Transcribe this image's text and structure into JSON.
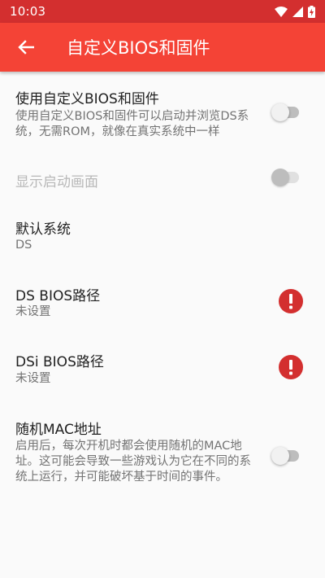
{
  "status_bar": {
    "time": "10:03",
    "icons": [
      "wifi-icon",
      "signal-icon",
      "battery-charging-icon"
    ]
  },
  "app_bar": {
    "title": "自定义BIOS和固件",
    "back_icon": "arrow-back-icon"
  },
  "colors": {
    "app_bar": "#f44336",
    "status_bar": "#d32f2f",
    "error": "#d32f2f"
  },
  "preferences": [
    {
      "title": "使用自定义BIOS和固件",
      "summary": "使用自定义BIOS和固件可以启动并浏览DS系统，无需ROM，就像在真实系统中一样",
      "control": "switch",
      "checked": false,
      "enabled": true
    },
    {
      "title": "显示启动画面",
      "control": "switch",
      "checked": false,
      "enabled": false
    },
    {
      "title": "默认系统",
      "summary": "DS"
    },
    {
      "title": "DS BIOS路径",
      "summary": "未设置",
      "status_icon": "error-icon"
    },
    {
      "title": "DSi BIOS路径",
      "summary": "未设置",
      "status_icon": "error-icon"
    },
    {
      "title": "随机MAC地址",
      "summary": "启用后，每次开机时都会使用随机的MAC地址。这可能会导致一些游戏认为它在不同的系统上运行，并可能破坏基于时间的事件。",
      "control": "switch",
      "checked": false,
      "enabled": true
    }
  ]
}
